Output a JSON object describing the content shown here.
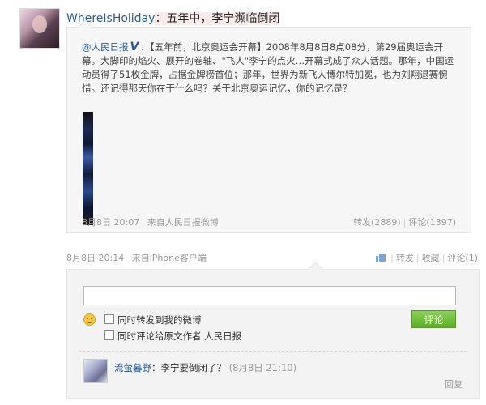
{
  "post": {
    "username": "WhereIsHoliday",
    "colon": "：",
    "text": "五年中，李宁濒临倒闭"
  },
  "retweet": {
    "author": "@人民日报",
    "verified": "V",
    "body_part1": "：【五年前，北京奥运会开幕】2008年8月8日8点08分，第29届奥运会开幕。大脚印的焰火、展开的卷轴、\"飞人\"李宁的点火…开幕式成了众人话题。那年，中国运动员得了51枚金牌，占据金牌榜首位；那年，世界为新飞人博尔特加冕，也为刘翔退赛惋惜。还记得那天你在干什么吗？关于北京奥运记忆，你的记忆是？",
    "time": "8月8日 20:07",
    "source_prefix": "来自",
    "source": "人民日报微博",
    "forward": "转发(2889)",
    "comment": "评论(1397)"
  },
  "meta": {
    "time": "8月8日 20:14",
    "source_prefix": "来自",
    "source": "iPhone客户端",
    "like_count": "",
    "forward": "转发",
    "favorite": "收藏",
    "comment": "评论(1)"
  },
  "comment_form": {
    "input_value": "",
    "option1": "同时转发到我的微博",
    "option2": "同时评论给原文作者 人民日报",
    "submit": "评论"
  },
  "comments": [
    {
      "user": "流萤暮野",
      "text": "：李宁要倒闭了？",
      "time": "(8月8日 21:10)",
      "reply": "回复"
    }
  ]
}
